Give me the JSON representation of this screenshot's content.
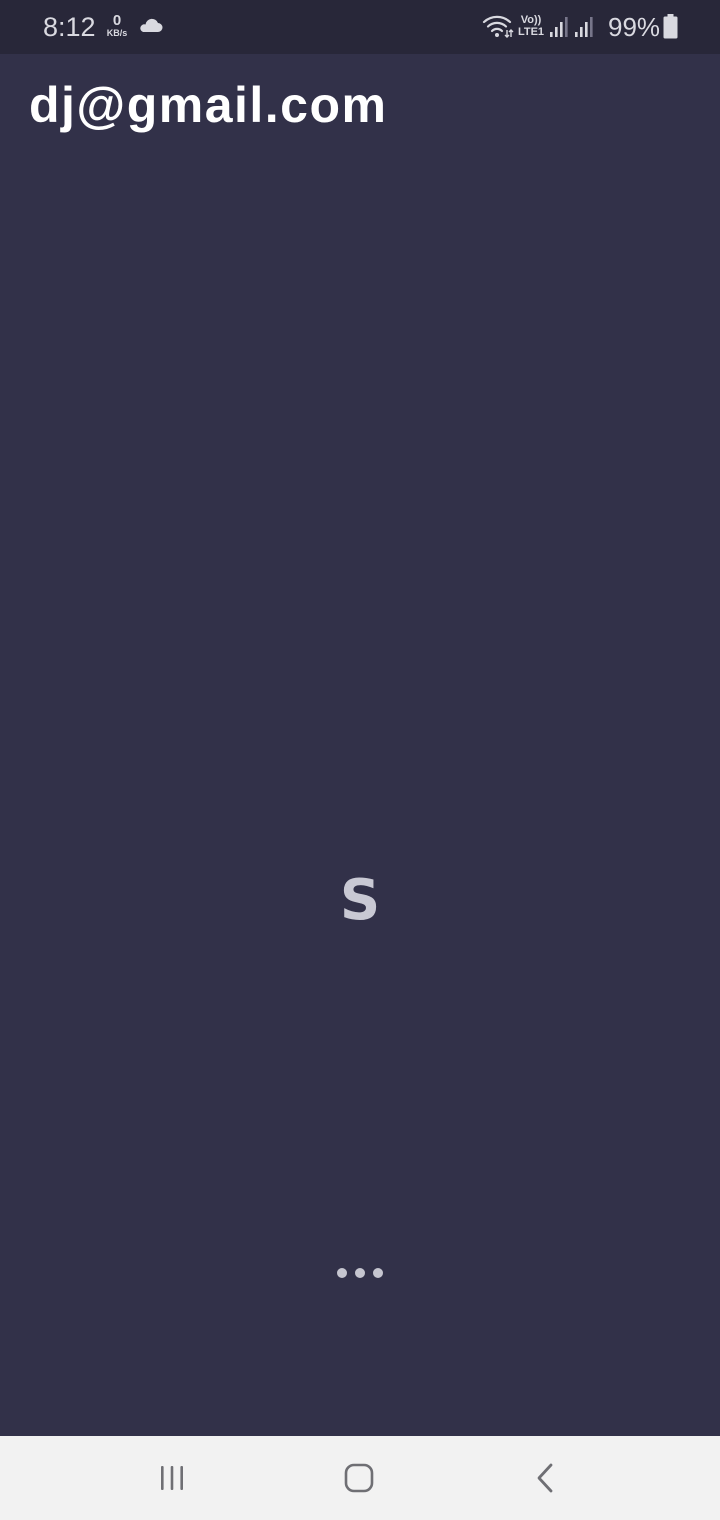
{
  "status_bar": {
    "time": "8:12",
    "net_speed_value": "0",
    "net_speed_unit": "KB/s",
    "volte_top": "Vo))",
    "volte_bottom": "LTE1",
    "battery_percent": "99%",
    "icons": [
      "cloud-icon",
      "wifi-icon",
      "volte-icon",
      "signal-icon",
      "signal-icon",
      "battery-icon"
    ]
  },
  "header": {
    "account_email": "dj@gmail.com"
  },
  "splash": {
    "logo_letter": "S"
  },
  "nav_bar": {
    "icons": [
      "recents-icon",
      "home-icon",
      "back-icon"
    ]
  },
  "colors": {
    "background": "#323149",
    "status_bar": "#282739",
    "nav_bar": "#f2f2f2",
    "text_primary": "#ffffff",
    "logo": "#c9c9d4"
  }
}
